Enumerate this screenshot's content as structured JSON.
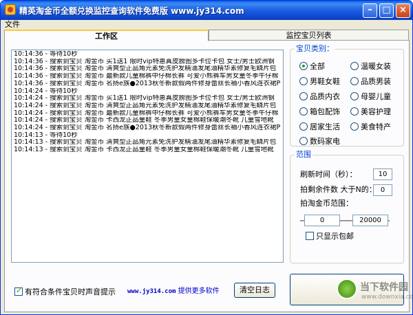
{
  "window": {
    "title": "精英淘金币全额兑换监控查询软件免费版  www.jy314.com",
    "minimize_glyph": "–",
    "maximize_glyph": "□",
    "close_glyph": "×"
  },
  "menu": {
    "file": "文件"
  },
  "tabs": [
    {
      "label": "工作区",
      "active": true
    },
    {
      "label": "监控宝贝列表",
      "active": false
    }
  ],
  "log": [
    "10:14:36 - 等待10秒",
    "10:14:36 - 搜索到宝贝 淘金币 买1送1 限时vip特惠真皮膀图多卡位卡包 女士/男士欧洲钢",
    "10:14:36 - 搜索到宝贝 淘金币 清爽型正品角元素免洗护发精油发尾油精华素修复毛鳞片包",
    "10:14:36 - 搜索到宝贝 淘金币 最新款儿童棉裤中仔棉长裤 可爱小熊裤车男女童冬季牛仔棉",
    "10:14:36 - 搜索到宝贝 淘金币 名扬e族●2013秋冬新款假两件修身蕾丝长袖小香风连衣裙P",
    "10:14:24 - 等待10秒",
    "10:14:24 - 搜索到宝贝 淘金币 买1送1 限时vip特惠真皮膀图多卡位卡包 女士/男士欧洲钢",
    "10:14:24 - 搜索到宝贝 淘金币 清爽型正品角元素免洗护发精油发尾油精华素修复毛鳞片包",
    "10:14:24 - 搜索到宝贝 淘金币 最新款儿童棉裤中仔棉长裤 可爱小熊裤车男女童冬季牛仔棉",
    "10:14:24 - 搜索到宝贝 淘金币 卡西龙正品童鞋 冬季男童女童棉鞋保暖潮冬靴 儿童雪地靴",
    "10:14:24 - 搜索到宝贝 淘金币 名扬e族●2013秋冬新款假两件修身蕾丝长袖小香风连衣裙P",
    "10:14:13 - 等待10秒",
    "10:14:13 - 搜索到宝贝 淘金币 清爽型正品角元素免洗护发精油发尾油精华素修复毛鳞片包",
    "10:14:13 - 搜索到宝贝 淘金币 卡西龙正品童鞋 冬季男童女童棉鞋保暖潮冬靴 儿童雪地靴"
  ],
  "category": {
    "title": "宝贝类别：",
    "options": [
      {
        "label": "全部",
        "selected": true
      },
      {
        "label": "温暖女装",
        "selected": false
      },
      {
        "label": "男鞋女鞋",
        "selected": false
      },
      {
        "label": "品质男装",
        "selected": false
      },
      {
        "label": "品质内衣",
        "selected": false
      },
      {
        "label": "母婴儿童",
        "selected": false
      },
      {
        "label": "箱包配饰",
        "selected": false
      },
      {
        "label": "美容护理",
        "selected": false
      },
      {
        "label": "居家生活",
        "selected": false
      },
      {
        "label": "美食特产",
        "selected": false
      },
      {
        "label": "数码家电",
        "selected": false
      }
    ]
  },
  "range": {
    "title": "范围",
    "refresh_label": "刷新时间（秒）：",
    "refresh_value": "10",
    "remaining_label": "拍剩余件数 大于N的：",
    "remaining_value": "0",
    "coin_range_label": "拍淘金币范围：",
    "coin_min": "0",
    "coin_max": "20000",
    "free_shipping_label": "只显示包邮",
    "free_shipping_checked": false
  },
  "footer": {
    "sound_alert_label": "有符合条件宝贝时声音提示",
    "sound_alert_checked": true,
    "link_url": "www.jy314.com",
    "link_text": "提供更多软件",
    "clear_log": "清空日志",
    "stop": "停止"
  },
  "watermark": {
    "brand": "当下软件园",
    "url": "www.downxia.com"
  },
  "colors": {
    "title_bar": "#0a5ee6",
    "group_title": "#0046d5",
    "link": "#0000c8",
    "window_bg": "#ece9d8"
  }
}
